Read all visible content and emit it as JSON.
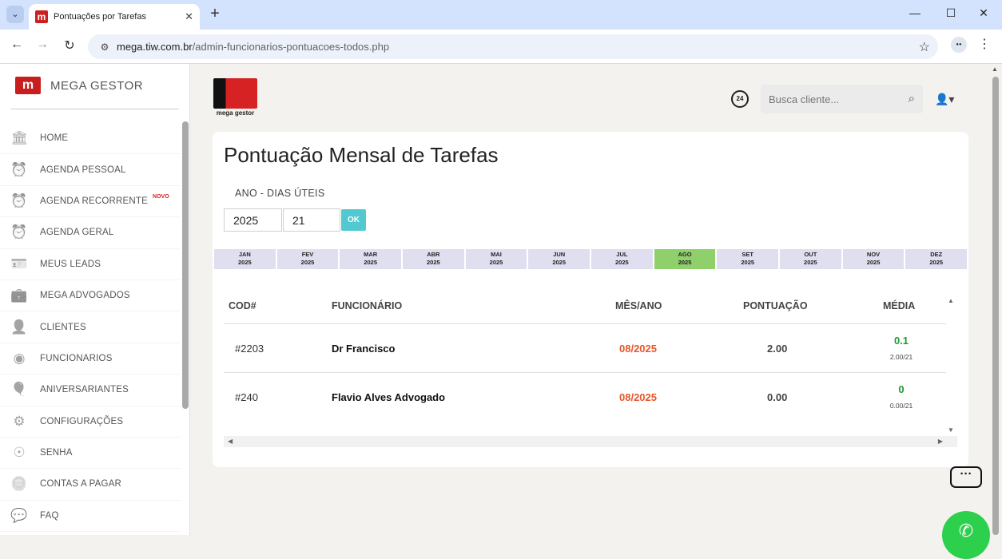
{
  "browser": {
    "tab_title": "Pontuações por Tarefas",
    "url_host": "mega.tiw.com.br",
    "url_path": "/admin-funcionarios-pontuacoes-todos.php"
  },
  "sidebar": {
    "brand": "MEGA GESTOR",
    "items": [
      {
        "label": "HOME",
        "icon": "bank-icon"
      },
      {
        "label": "AGENDA PESSOAL",
        "icon": "alarm-clock-icon"
      },
      {
        "label": "AGENDA RECORRENTE",
        "icon": "alarm-clock-icon",
        "badge": "NOVO"
      },
      {
        "label": "AGENDA GERAL",
        "icon": "alarm-clock-icon"
      },
      {
        "label": "MEUS LEADS",
        "icon": "contact-card-icon"
      },
      {
        "label": "MEGA ADVOGADOS",
        "icon": "briefcase-icon"
      },
      {
        "label": "CLIENTES",
        "icon": "user-icon"
      },
      {
        "label": "FUNCIONARIOS",
        "icon": "user-circle-icon"
      },
      {
        "label": "ANIVERSARIANTES",
        "icon": "balloon-icon"
      },
      {
        "label": "CONFIGURAÇÕES",
        "icon": "gear-icon"
      },
      {
        "label": "SENHA",
        "icon": "fingerprint-icon"
      },
      {
        "label": "CONTAS A PAGAR",
        "icon": "coins-icon"
      },
      {
        "label": "FAQ",
        "icon": "chat-bubble-icon"
      }
    ]
  },
  "header": {
    "logo_text": "mega gestor",
    "search_placeholder": "Busca cliente...",
    "history_badge": "24"
  },
  "page": {
    "title": "Pontuação Mensal de Tarefas",
    "filter_label": "ANO - DIAS ÚTEIS",
    "year_value": "2025",
    "days_value": "21",
    "ok_label": "OK"
  },
  "months": [
    {
      "m": "JAN",
      "y": "2025"
    },
    {
      "m": "FEV",
      "y": "2025"
    },
    {
      "m": "MAR",
      "y": "2025"
    },
    {
      "m": "ABR",
      "y": "2025"
    },
    {
      "m": "MAI",
      "y": "2025"
    },
    {
      "m": "JUN",
      "y": "2025"
    },
    {
      "m": "JUL",
      "y": "2025"
    },
    {
      "m": "AGO",
      "y": "2025",
      "active": true
    },
    {
      "m": "SET",
      "y": "2025"
    },
    {
      "m": "OUT",
      "y": "2025"
    },
    {
      "m": "NOV",
      "y": "2025"
    },
    {
      "m": "DEZ",
      "y": "2025"
    }
  ],
  "table": {
    "headers": {
      "cod": "COD#",
      "funcionario": "FUNCIONÁRIO",
      "mes": "MÊS/ANO",
      "pontuacao": "PONTUAÇÃO",
      "media": "MÉDIA"
    },
    "rows": [
      {
        "cod": "#2203",
        "funcionario": "Dr Francisco",
        "mes": "08/2025",
        "pontuacao": "2.00",
        "media": "0.1",
        "media_sub": "2.00/21"
      },
      {
        "cod": "#240",
        "funcionario": "Flavio Alves Advogado",
        "mes": "08/2025",
        "pontuacao": "0.00",
        "media": "0",
        "media_sub": "0.00/21"
      }
    ]
  },
  "colors": {
    "active_month": "#8fd06c",
    "month_bg": "#e0dff0",
    "ok_button": "#52c9d0",
    "mes_text": "#e8562a",
    "media_text": "#1f9a33",
    "whatsapp": "#2dd04c"
  }
}
